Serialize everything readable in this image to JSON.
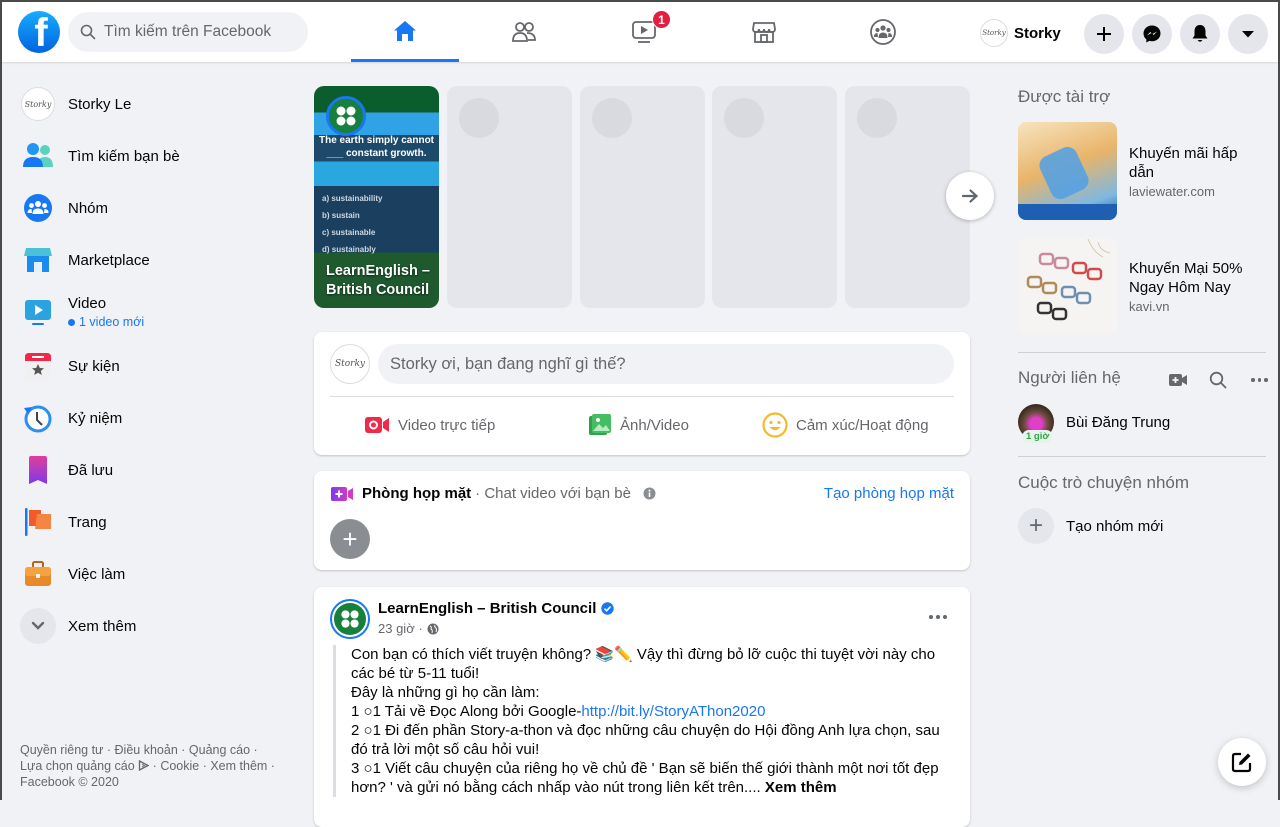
{
  "topbar": {
    "logo": "f",
    "search_placeholder": "Tìm kiếm trên Facebook",
    "nav_tabs": [
      {
        "name": "home",
        "icon": "home-icon",
        "active": true
      },
      {
        "name": "friends",
        "icon": "friends-icon",
        "active": false
      },
      {
        "name": "watch",
        "icon": "watch-icon",
        "active": false,
        "badge": "1"
      },
      {
        "name": "marketplace",
        "icon": "marketplace-icon",
        "active": false
      },
      {
        "name": "groups",
        "icon": "groups-icon",
        "active": false
      }
    ],
    "profile_name": "Storky",
    "profile_avatar_text": "Storky",
    "actions": [
      "create-plus-icon",
      "messenger-icon",
      "notifications-bell-icon",
      "account-caret-icon"
    ]
  },
  "leftnav": {
    "items": [
      {
        "label": "Storky Le",
        "icon": "profile-avatar"
      },
      {
        "label": "Tìm kiếm bạn bè",
        "icon": "friends-icon"
      },
      {
        "label": "Nhóm",
        "icon": "groups-icon"
      },
      {
        "label": "Marketplace",
        "icon": "marketplace-icon"
      },
      {
        "label": "Video",
        "icon": "video-icon",
        "sub": "1 video mới"
      },
      {
        "label": "Sự kiện",
        "icon": "events-icon"
      },
      {
        "label": "Kỷ niệm",
        "icon": "memories-icon"
      },
      {
        "label": "Đã lưu",
        "icon": "saved-icon"
      },
      {
        "label": "Trang",
        "icon": "pages-icon"
      },
      {
        "label": "Việc làm",
        "icon": "jobs-icon"
      },
      {
        "label": "Xem thêm",
        "icon": "chevron-down-icon"
      }
    ],
    "footer": {
      "links": [
        "Quyền riêng tư",
        "Điều khoản",
        "Quảng cáo",
        "Lựa chọn quảng cáo",
        "Cookie",
        "Xem thêm"
      ],
      "copyright": "Facebook © 2020"
    }
  },
  "stories": {
    "main": {
      "name": "LearnEnglish – British Council",
      "question": "The earth simply cannot ___ constant growth.",
      "options": [
        "a) sustainability",
        "b) sustain",
        "c) sustainable",
        "d) sustainably"
      ]
    },
    "placeholder_count": 4
  },
  "composer": {
    "placeholder": "Storky ơi, bạn đang nghĩ gì thế?",
    "actions": [
      {
        "label": "Video trực tiếp",
        "icon": "live-video-icon",
        "color": "#f02849"
      },
      {
        "label": "Ảnh/Video",
        "icon": "photo-video-icon",
        "color": "#45bd62"
      },
      {
        "label": "Cảm xúc/Hoạt động",
        "icon": "feeling-icon",
        "color": "#f7b928"
      }
    ]
  },
  "rooms": {
    "title": "Phòng họp mặt",
    "subtitle": "· Chat video với bạn bè",
    "create_label": "Tạo phòng họp mặt"
  },
  "post": {
    "author": "LearnEnglish – British Council",
    "verified": true,
    "time": "23 giờ ·",
    "privacy": "public",
    "body": {
      "line1": "Con bạn có thích viết truyện không? 📚✏️ Vậy thì đừng bỏ lỡ cuộc thi tuyệt vời này cho các bé từ 5-11 tuổi!",
      "line2": "Đây là những gì họ cần làm:",
      "step1_prefix": "1 ○1 Tải về Đọc Along bởi Google-",
      "step1_link": "http://bit.ly/StoryAThon2020",
      "step2": "2 ○1 Đi đến phần Story-a-thon và đọc những câu chuyện do Hội đồng Anh lựa chọn, sau đó trả lời một số câu hỏi vui!",
      "step3": "3 ○1 Viết câu chuyện của riêng họ về chủ đề ' Bạn sẽ biến thế giới thành một nơi tốt đẹp hơn? ' và gửi nó bằng cách nhấp vào nút trong liên kết trên....",
      "see_more": "Xem thêm"
    }
  },
  "rightcol": {
    "sponsored_title": "Được tài trợ",
    "ads": [
      {
        "title": "Khuyến mãi hấp dẫn",
        "domain": "laviewater.com"
      },
      {
        "title": "Khuyến Mại 50% Ngay Hôm Nay",
        "domain": "kavi.vn"
      }
    ],
    "contacts_title": "Người liên hệ",
    "contacts": [
      {
        "name": "Bùi Đăng Trung",
        "status": "1 giờ"
      }
    ],
    "group_chats_title": "Cuộc trò chuyện nhóm",
    "new_group_label": "Tạo nhóm mới"
  }
}
